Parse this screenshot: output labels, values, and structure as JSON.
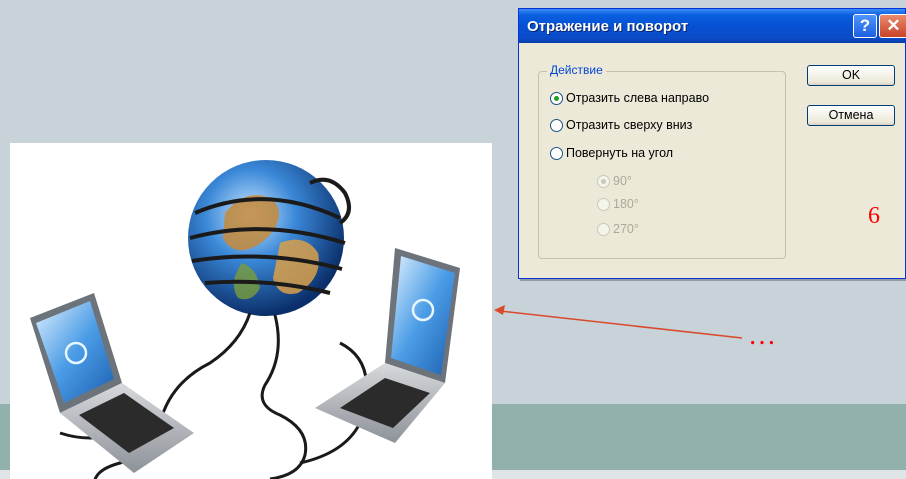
{
  "dialog": {
    "title": "Отражение и поворот",
    "help_symbol": "?",
    "close_symbol": "✕",
    "group_label": "Действие",
    "options": [
      {
        "label": "Отразить слева направо",
        "checked": true,
        "enabled": true
      },
      {
        "label": "Отразить сверху вниз",
        "checked": false,
        "enabled": true
      },
      {
        "label": "Повернуть на угол",
        "checked": false,
        "enabled": true
      }
    ],
    "angles": [
      {
        "label": "90°",
        "checked": true,
        "enabled": false
      },
      {
        "label": "180°",
        "checked": false,
        "enabled": false
      },
      {
        "label": "270°",
        "checked": false,
        "enabled": false
      }
    ],
    "ok_label": "OK",
    "cancel_label": "Отмена"
  },
  "slide": {
    "number": "6",
    "ellipsis": "…",
    "accent_color": "#ff0000",
    "band_color": "#93b1ac",
    "background_color": "#c8d2d9"
  },
  "picture": {
    "icons": [
      "globe-icon",
      "laptop-icon",
      "cable-icon"
    ]
  }
}
